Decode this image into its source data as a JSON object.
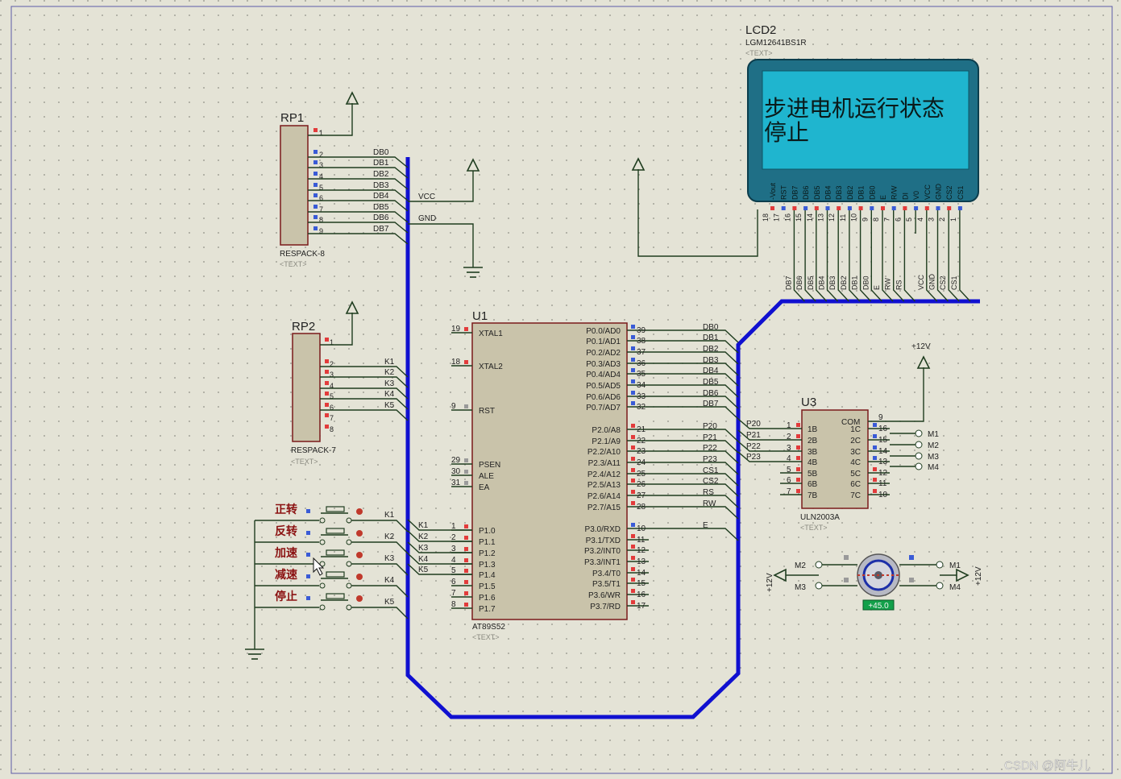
{
  "lcd": {
    "ref": "LCD2",
    "model": "LGM12641BS1R",
    "text_tag": "<TEXT>",
    "line1": "步进电机运行状态",
    "line2": "停止",
    "pin_labels": [
      "-Vout",
      "RST",
      "DB7",
      "DB6",
      "DB5",
      "DB4",
      "DB3",
      "DB2",
      "DB1",
      "DB0",
      "E",
      "R/W",
      "DI",
      "V0",
      "VCC",
      "GND",
      "CS2",
      "CS1"
    ],
    "pin_numbers": [
      "18",
      "17",
      "16",
      "15",
      "14",
      "13",
      "12",
      "11",
      "10",
      "9",
      "8",
      "7",
      "6",
      "5",
      "4",
      "3",
      "2",
      "1"
    ],
    "net_labels": [
      "DB7",
      "DB6",
      "DB5",
      "DB4",
      "DB3",
      "DB2",
      "DB1",
      "DB0",
      "E",
      "RW",
      "RS",
      "VCC",
      "GND",
      "CS2",
      "CS1"
    ]
  },
  "rp1": {
    "ref": "RP1",
    "model": "RESPACK-8",
    "text_tag": "<TEXT>",
    "pins": [
      "1",
      "2",
      "3",
      "4",
      "5",
      "6",
      "7",
      "8",
      "9"
    ],
    "nets": [
      "DB0",
      "DB1",
      "DB2",
      "DB3",
      "DB4",
      "DB5",
      "DB6",
      "DB7"
    ]
  },
  "rp2": {
    "ref": "RP2",
    "model": "RESPACK-7",
    "text_tag": "<TEXT>",
    "pins": [
      "1",
      "2",
      "3",
      "4",
      "5",
      "6",
      "7",
      "8"
    ],
    "nets": [
      "K1",
      "K2",
      "K3",
      "K4",
      "K5"
    ]
  },
  "power": {
    "vcc": "VCC",
    "gnd": "GND",
    "plus12": "+12V"
  },
  "u1": {
    "ref": "U1",
    "model": "AT89S52",
    "text_tag": "<TEXT>",
    "left_pins": [
      {
        "num": "19",
        "name": "XTAL1"
      },
      {
        "num": "18",
        "name": "XTAL2"
      },
      {
        "num": "9",
        "name": "RST"
      },
      {
        "num": "29",
        "name": "PSEN"
      },
      {
        "num": "30",
        "name": "ALE"
      },
      {
        "num": "31",
        "name": "EA"
      },
      {
        "num": "1",
        "name": "P1.0"
      },
      {
        "num": "2",
        "name": "P1.1"
      },
      {
        "num": "3",
        "name": "P1.2"
      },
      {
        "num": "4",
        "name": "P1.3"
      },
      {
        "num": "5",
        "name": "P1.4"
      },
      {
        "num": "6",
        "name": "P1.5"
      },
      {
        "num": "7",
        "name": "P1.6"
      },
      {
        "num": "8",
        "name": "P1.7"
      }
    ],
    "right_pins": [
      {
        "num": "39",
        "name": "P0.0/AD0",
        "net": "DB0"
      },
      {
        "num": "38",
        "name": "P0.1/AD1",
        "net": "DB1"
      },
      {
        "num": "37",
        "name": "P0.2/AD2",
        "net": "DB2"
      },
      {
        "num": "36",
        "name": "P0.3/AD3",
        "net": "DB3"
      },
      {
        "num": "35",
        "name": "P0.4/AD4",
        "net": "DB4"
      },
      {
        "num": "34",
        "name": "P0.5/AD5",
        "net": "DB5"
      },
      {
        "num": "33",
        "name": "P0.6/AD6",
        "net": "DB6"
      },
      {
        "num": "32",
        "name": "P0.7/AD7",
        "net": "DB7"
      },
      {
        "num": "21",
        "name": "P2.0/A8",
        "net": "P20"
      },
      {
        "num": "22",
        "name": "P2.1/A9",
        "net": "P21"
      },
      {
        "num": "23",
        "name": "P2.2/A10",
        "net": "P22"
      },
      {
        "num": "24",
        "name": "P2.3/A11",
        "net": "P23"
      },
      {
        "num": "25",
        "name": "P2.4/A12",
        "net": "CS1"
      },
      {
        "num": "26",
        "name": "P2.5/A13",
        "net": "CS2"
      },
      {
        "num": "27",
        "name": "P2.6/A14",
        "net": "RS"
      },
      {
        "num": "28",
        "name": "P2.7/A15",
        "net": "RW"
      },
      {
        "num": "10",
        "name": "P3.0/RXD",
        "net": "E"
      },
      {
        "num": "11",
        "name": "P3.1/TXD",
        "net": ""
      },
      {
        "num": "12",
        "name": "P3.2/INT0",
        "net": ""
      },
      {
        "num": "13",
        "name": "P3.3/INT1",
        "net": ""
      },
      {
        "num": "14",
        "name": "P3.4/T0",
        "net": ""
      },
      {
        "num": "15",
        "name": "P3.5/T1",
        "net": ""
      },
      {
        "num": "16",
        "name": "P3.6/WR",
        "net": ""
      },
      {
        "num": "17",
        "name": "P3.7/RD",
        "net": ""
      }
    ],
    "p1_nets": [
      "K1",
      "K2",
      "K3",
      "K4",
      "K5"
    ]
  },
  "u3": {
    "ref": "U3",
    "model": "ULN2003A",
    "text_tag": "<TEXT>",
    "inputs": [
      {
        "num": "1",
        "name": "1B"
      },
      {
        "num": "2",
        "name": "2B"
      },
      {
        "num": "3",
        "name": "3B"
      },
      {
        "num": "4",
        "name": "4B"
      },
      {
        "num": "5",
        "name": "5B"
      },
      {
        "num": "6",
        "name": "6B"
      },
      {
        "num": "7",
        "name": "7B"
      }
    ],
    "com": {
      "num": "9",
      "name": "COM"
    },
    "outputs": [
      {
        "num": "16",
        "name": "1C"
      },
      {
        "num": "15",
        "name": "2C"
      },
      {
        "num": "14",
        "name": "3C"
      },
      {
        "num": "13",
        "name": "4C"
      },
      {
        "num": "12",
        "name": "5C"
      },
      {
        "num": "11",
        "name": "6C"
      },
      {
        "num": "10",
        "name": "7C"
      }
    ],
    "in_nets": [
      "P20",
      "P21",
      "P22",
      "P23"
    ],
    "out_nets": [
      "M1",
      "M2",
      "M3",
      "M4"
    ]
  },
  "buttons": [
    {
      "label": "正转",
      "net": "K1"
    },
    {
      "label": "反转",
      "net": "K2"
    },
    {
      "label": "加速",
      "net": "K3"
    },
    {
      "label": "减速",
      "net": "K4"
    },
    {
      "label": "停止",
      "net": "K5"
    }
  ],
  "button_bus_labels": [
    "K1",
    "K2",
    "K3",
    "K4",
    "K5"
  ],
  "motor": {
    "left_labels": [
      "M2",
      "M3"
    ],
    "right_labels": [
      "M1",
      "M4"
    ],
    "supply": "+12V",
    "angle": "+45.0"
  },
  "watermark": "CSDN @阿牛儿",
  "colors": {
    "background": "#e4e3d6",
    "wire": "#1f3d1f",
    "bus": "#1010d0",
    "component_fill": "#c9c3aa",
    "component_border": "#7a1a1a",
    "lcd_screen": "#1fb5cf",
    "lcd_bezel": "#1f6f86"
  }
}
